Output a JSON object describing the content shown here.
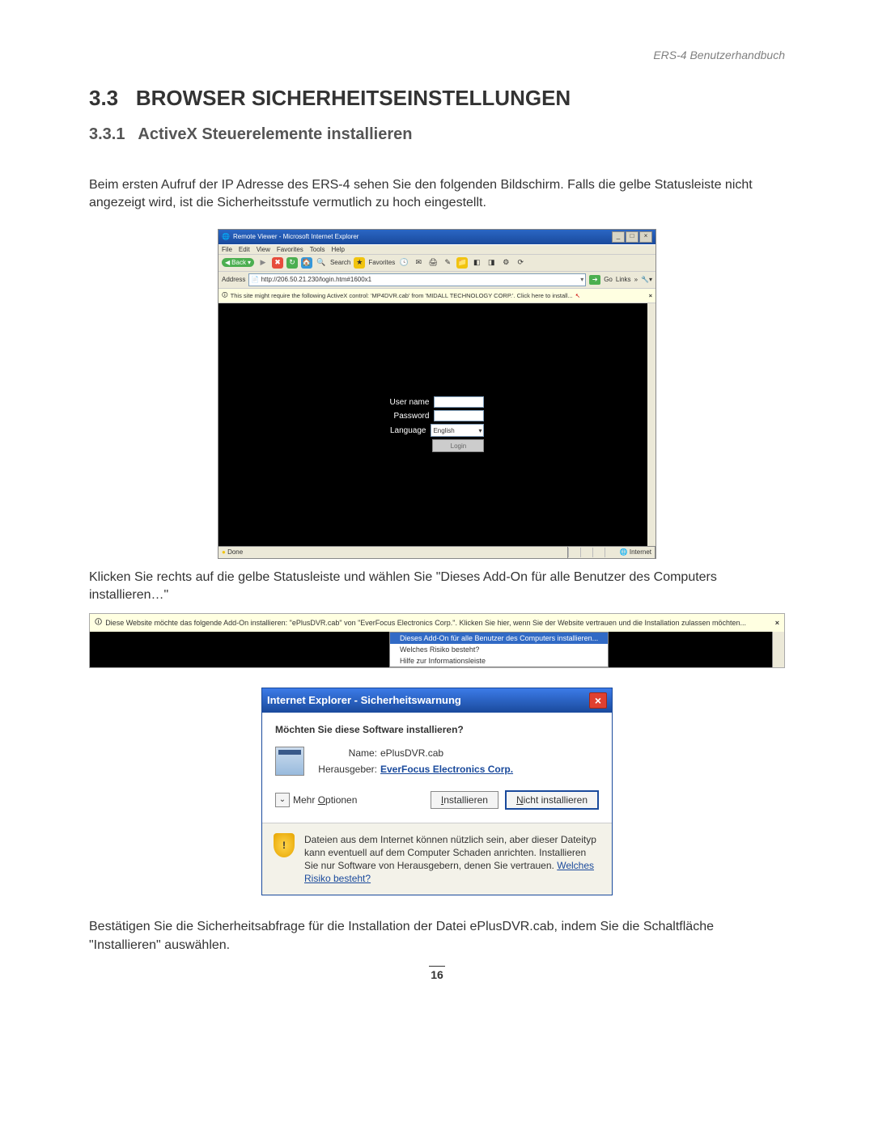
{
  "header": "ERS-4  Benutzerhandbuch",
  "section_number": "3.3",
  "section_title": "BROWSER SICHERHEITSEINSTELLUNGEN",
  "subsection_number": "3.3.1",
  "subsection_title": "ActiveX Steuerelemente installieren",
  "para1": "Beim ersten Aufruf der IP Adresse des ERS-4 sehen Sie den folgenden Bildschirm. Falls die gelbe Statusleiste nicht angezeigt wird, ist die Sicherheitsstufe vermutlich zu hoch eingestellt.",
  "ie": {
    "title": "Remote Viewer - Microsoft Internet Explorer",
    "menus": [
      "File",
      "Edit",
      "View",
      "Favorites",
      "Tools",
      "Help"
    ],
    "back": "Back",
    "search": "Search",
    "favorites": "Favorites",
    "address_label": "Address",
    "url": "http://206.50.21.230/login.htm#1600x1",
    "go": "Go",
    "links": "Links",
    "infobar": "This site might require the following ActiveX control: 'MP4DVR.cab' from 'MIDALL TECHNOLOGY CORP.'. Click here to install...",
    "login": {
      "user_label": "User name",
      "pass_label": "Password",
      "lang_label": "Language",
      "lang_val": "English",
      "button": "Login"
    },
    "status_done": "Done",
    "status_zone": "Internet"
  },
  "para2": "Klicken Sie rechts auf die gelbe Statusleiste und wählen Sie \"Dieses Add-On für alle Benutzer des Computers installieren…\"",
  "infobar2": {
    "text": "Diese Website möchte das folgende Add-On installieren: \"ePlusDVR.cab\" von \"EverFocus Electronics Corp.\". Klicken Sie hier, wenn Sie der Website vertrauen und die Installation zulassen möchten...",
    "menu": [
      "Dieses Add-On für alle Benutzer des Computers installieren...",
      "Welches Risiko besteht?",
      "Hilfe zur Informationsleiste"
    ]
  },
  "dialog": {
    "title": "Internet Explorer - Sicherheitswarnung",
    "question": "Möchten Sie diese Software installieren?",
    "name_label": "Name:",
    "name_value": "ePlusDVR.cab",
    "publisher_label": "Herausgeber:",
    "publisher_value": "EverFocus Electronics Corp.",
    "more_options": "Mehr Optionen",
    "install": "Installieren",
    "dont_install": "Nicht installieren",
    "warning_text": "Dateien aus dem Internet können nützlich sein, aber dieser Dateityp kann eventuell auf dem Computer Schaden anrichten. Installieren Sie nur Software von Herausgebern, denen Sie vertrauen.",
    "risk_link": "Welches Risiko besteht?"
  },
  "para3": "Bestätigen Sie die Sicherheitsabfrage für die Installation der Datei ePlusDVR.cab, indem Sie die Schaltfläche \"Installieren\" auswählen.",
  "page_number": "16"
}
